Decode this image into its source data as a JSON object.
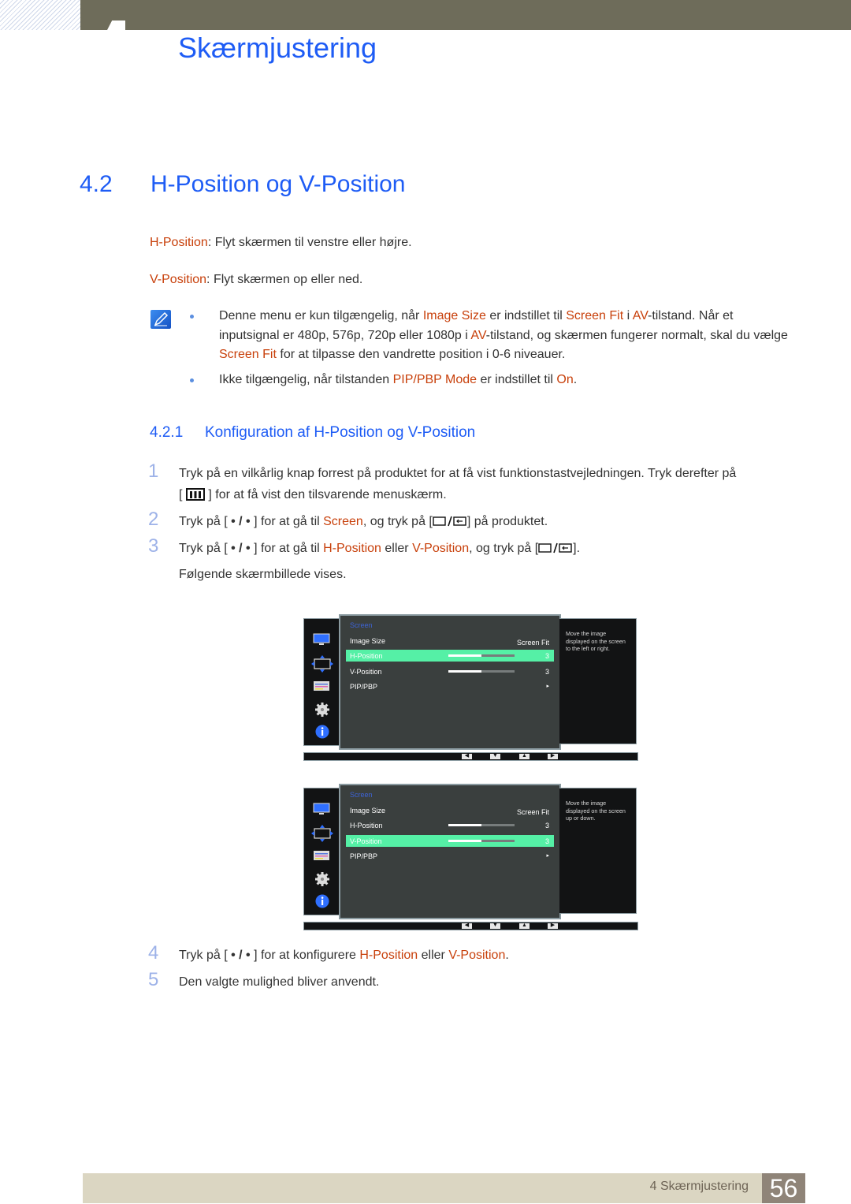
{
  "header": {
    "chapter_title": "Skærmjustering"
  },
  "section": {
    "number": "4.2",
    "title": "H-Position og V-Position"
  },
  "definitions": [
    {
      "term": "H-Position",
      "text": ": Flyt skærmen til venstre eller højre."
    },
    {
      "term": "V-Position",
      "text": ": Flyt skærmen op eller ned."
    }
  ],
  "notes": {
    "icon": "note-pencil-icon",
    "items": [
      {
        "parts": [
          {
            "t": "Denne menu er kun tilgængelig, når "
          },
          {
            "t": "Image Size",
            "hl": true
          },
          {
            "t": " er indstillet til "
          },
          {
            "t": "Screen Fit",
            "hl": true
          },
          {
            "t": " i "
          },
          {
            "t": "AV",
            "hl": true
          },
          {
            "t": "-tilstand. Når et inputsignal er 480p, 576p, 720p eller 1080p i "
          },
          {
            "t": "AV",
            "hl": true
          },
          {
            "t": "-tilstand, og skærmen fungerer normalt, skal du vælge "
          },
          {
            "t": "Screen Fit",
            "hl": true
          },
          {
            "t": " for at tilpasse den vandrette position i 0-6 niveauer."
          }
        ]
      },
      {
        "parts": [
          {
            "t": "Ikke tilgængelig, når tilstanden "
          },
          {
            "t": "PIP/PBP Mode",
            "hl": true
          },
          {
            "t": " er indstillet til "
          },
          {
            "t": "On",
            "hl": true
          },
          {
            "t": "."
          }
        ]
      }
    ]
  },
  "subsection": {
    "number": "4.2.1",
    "title": "Konfiguration af H-Position og V-Position"
  },
  "steps": {
    "s1": {
      "n": "1",
      "a": "Tryk på en vilkårlig knap forrest på produktet for at få vist funktionstastvejledningen. Tryk derefter på",
      "b": "[",
      "c": "] for at få vist den tilsvarende menuskærm."
    },
    "s2": {
      "n": "2",
      "a": "Tryk på [ ",
      "dots": "• / •",
      "b": " ] for at gå til ",
      "hl1": "Screen",
      "c": ", og tryk på [",
      "d": "] på produktet."
    },
    "s3": {
      "n": "3",
      "a": "Tryk på [ ",
      "dots": "• / •",
      "b": " ] for at gå til ",
      "hl1": "H-Position",
      "c": " eller ",
      "hl2": "V-Position",
      "d": ", og tryk på [",
      "e": "].",
      "f": "Følgende skærmbillede vises."
    },
    "s4": {
      "n": "4",
      "a": "Tryk på [ ",
      "dots": "• / •",
      "b": " ] for at konfigurere ",
      "hl1": "H-Position",
      "c": " eller ",
      "hl2": "V-Position",
      "d": "."
    },
    "s5": {
      "n": "5",
      "a": "Den valgte mulighed bliver anvendt."
    }
  },
  "osd": [
    {
      "menu_title": "Screen",
      "rows": [
        {
          "label": "Image Size",
          "value": "Screen Fit"
        },
        {
          "label": "H-Position",
          "value": "3",
          "level": 0.5,
          "selected": true
        },
        {
          "label": "V-Position",
          "value": "3",
          "level": 0.5
        },
        {
          "label": "PIP/PBP",
          "value": "▸"
        }
      ],
      "help": "Move the image displayed on the screen to the left or right.",
      "nav_buttons": [
        "◀",
        "▼",
        "▲",
        "▶"
      ]
    },
    {
      "menu_title": "Screen",
      "rows": [
        {
          "label": "Image Size",
          "value": "Screen Fit"
        },
        {
          "label": "H-Position",
          "value": "3",
          "level": 0.5
        },
        {
          "label": "V-Position",
          "value": "3",
          "level": 0.5,
          "selected": true
        },
        {
          "label": "PIP/PBP",
          "value": "▸"
        }
      ],
      "help": "Move the image displayed on the screen up or down.",
      "nav_buttons": [
        "◀",
        "▼",
        "▲",
        "▶"
      ]
    }
  ],
  "footer": {
    "chapter": "4 Skærmjustering",
    "page": "56"
  },
  "colors": {
    "heading_blue": "#1e5cf5",
    "highlight_orange": "#c8400b",
    "osd_selected": "#55f0a6"
  }
}
